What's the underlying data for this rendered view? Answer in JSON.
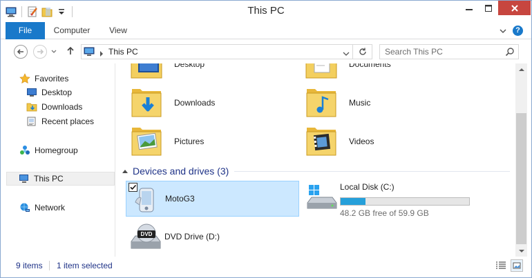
{
  "window": {
    "title": "This PC"
  },
  "quick_access": {
    "icons": [
      "computer-icon",
      "properties-icon",
      "new-folder-icon",
      "customize-dropdown-icon"
    ]
  },
  "ribbon": {
    "tabs": [
      {
        "label": "File",
        "active": true
      },
      {
        "label": "Computer",
        "active": false
      },
      {
        "label": "View",
        "active": false
      }
    ],
    "help_label": "?"
  },
  "navigation": {
    "address": {
      "crumbs": [
        "This PC"
      ]
    },
    "search": {
      "placeholder": "Search This PC"
    }
  },
  "sidebar": {
    "favorites": {
      "label": "Favorites",
      "items": [
        {
          "label": "Desktop",
          "icon": "desktop-icon"
        },
        {
          "label": "Downloads",
          "icon": "downloads-icon"
        },
        {
          "label": "Recent places",
          "icon": "recent-places-icon"
        }
      ]
    },
    "homegroup": {
      "label": "Homegroup"
    },
    "this_pc": {
      "label": "This PC",
      "selected": true
    },
    "network": {
      "label": "Network"
    }
  },
  "content": {
    "folders": [
      {
        "label": "Desktop",
        "icon": "desktop-folder-icon"
      },
      {
        "label": "Documents",
        "icon": "documents-folder-icon"
      },
      {
        "label": "Downloads",
        "icon": "downloads-folder-icon"
      },
      {
        "label": "Music",
        "icon": "music-folder-icon"
      },
      {
        "label": "Pictures",
        "icon": "pictures-folder-icon"
      },
      {
        "label": "Videos",
        "icon": "videos-folder-icon"
      }
    ],
    "devices_group": {
      "title": "Devices and drives (3)",
      "devices": [
        {
          "label": "MotoG3",
          "icon": "phone-icon",
          "selected": true,
          "checked": true
        },
        {
          "label": "Local Disk (C:)",
          "icon": "local-disk-icon",
          "free_text": "48.2 GB free of 59.9 GB",
          "used_fraction": 0.195
        },
        {
          "label": "DVD Drive (D:)",
          "icon": "dvd-drive-icon",
          "badge": "DVD"
        }
      ]
    }
  },
  "status_bar": {
    "items_count": "9 items",
    "selection": "1 item selected"
  },
  "colors": {
    "file_tab": "#1979ca",
    "selection_bg": "#cce8ff",
    "selection_border": "#99d1ff",
    "close_button": "#c7463f",
    "drive_bar": "#26a0da",
    "group_title": "#1e3287"
  }
}
